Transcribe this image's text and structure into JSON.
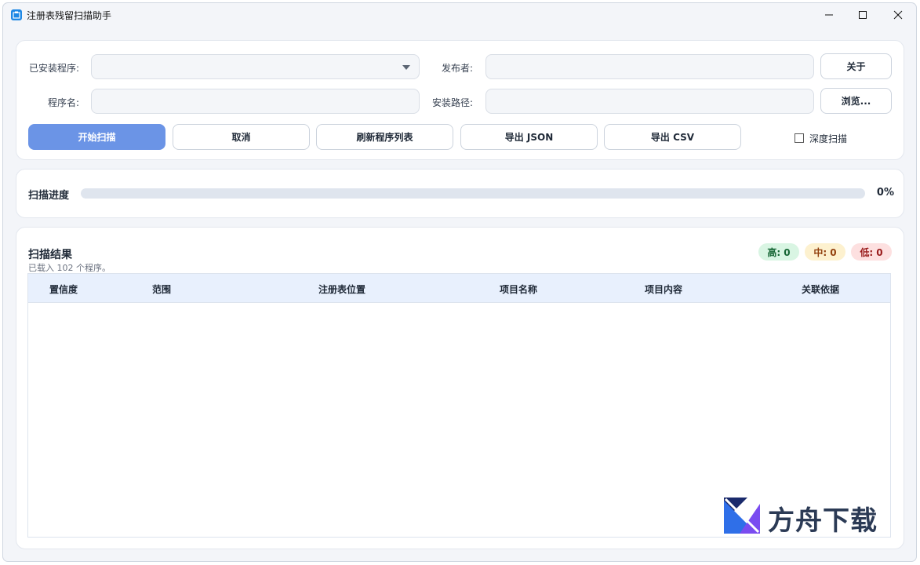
{
  "window": {
    "title": "注册表残留扫描助手",
    "controls": [
      "minimize-icon",
      "maximize-icon",
      "close-icon"
    ]
  },
  "form": {
    "installed_label": "已安装程序:",
    "installed_value": "",
    "publisher_label": "发布者:",
    "publisher_value": "",
    "name_label": "程序名:",
    "name_value": "",
    "path_label": "安装路径:",
    "path_value": "",
    "about_button": "关于",
    "browse_button": "浏览...",
    "deep_scan_label": "深度扫描",
    "deep_scan_checked": false
  },
  "actions": {
    "start": "开始扫描",
    "cancel": "取消",
    "refresh": "刷新程序列表",
    "export_json": "导出 JSON",
    "export_csv": "导出 CSV"
  },
  "progress": {
    "label": "扫描进度",
    "percent_text": "0%",
    "value": 0
  },
  "results": {
    "title": "扫描结果",
    "subtitle": "已载入 102 个程序。",
    "badges": {
      "high": "高: 0",
      "medium": "中: 0",
      "low": "低: 0"
    },
    "columns": [
      "置信度",
      "范围",
      "注册表位置",
      "项目名称",
      "项目内容",
      "关联依据"
    ],
    "rows": []
  },
  "watermark": {
    "text": "方舟下载"
  },
  "colors": {
    "accent": "#6b94e6",
    "badge_high_bg": "#d9f5e3",
    "badge_high_fg": "#166534",
    "badge_medium_bg": "#fdf1cf",
    "badge_medium_fg": "#92400e",
    "badge_low_bg": "#fde0e0",
    "badge_low_fg": "#991b1b"
  }
}
